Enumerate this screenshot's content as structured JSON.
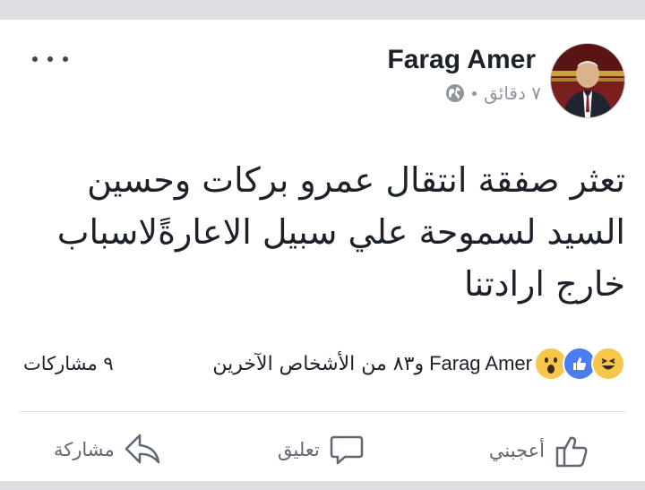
{
  "post": {
    "author": "Farag Amer",
    "time": "٧ دقائق",
    "text_lines": [
      "تعثر صفقة انتقال عمرو بركات وحسين",
      "السيد لسموحة علي سبيل الاعارةًلاسباب",
      "خارج ارادتنا"
    ]
  },
  "reactions": {
    "icons": [
      "haha-icon",
      "like-icon",
      "wow-icon"
    ],
    "name": "Farag Amer",
    "others": "و٨٣ من الأشخاص الآخرين"
  },
  "shares": "٩ مشاركات",
  "actions": {
    "like_label": "أعجبني",
    "comment_label": "تعليق",
    "share_label": "مشاركة"
  },
  "colors": {
    "like_blue": "#4a7df0",
    "reaction_yellow": "#f7c64a",
    "text": "#1d2129",
    "muted": "#90949c"
  }
}
